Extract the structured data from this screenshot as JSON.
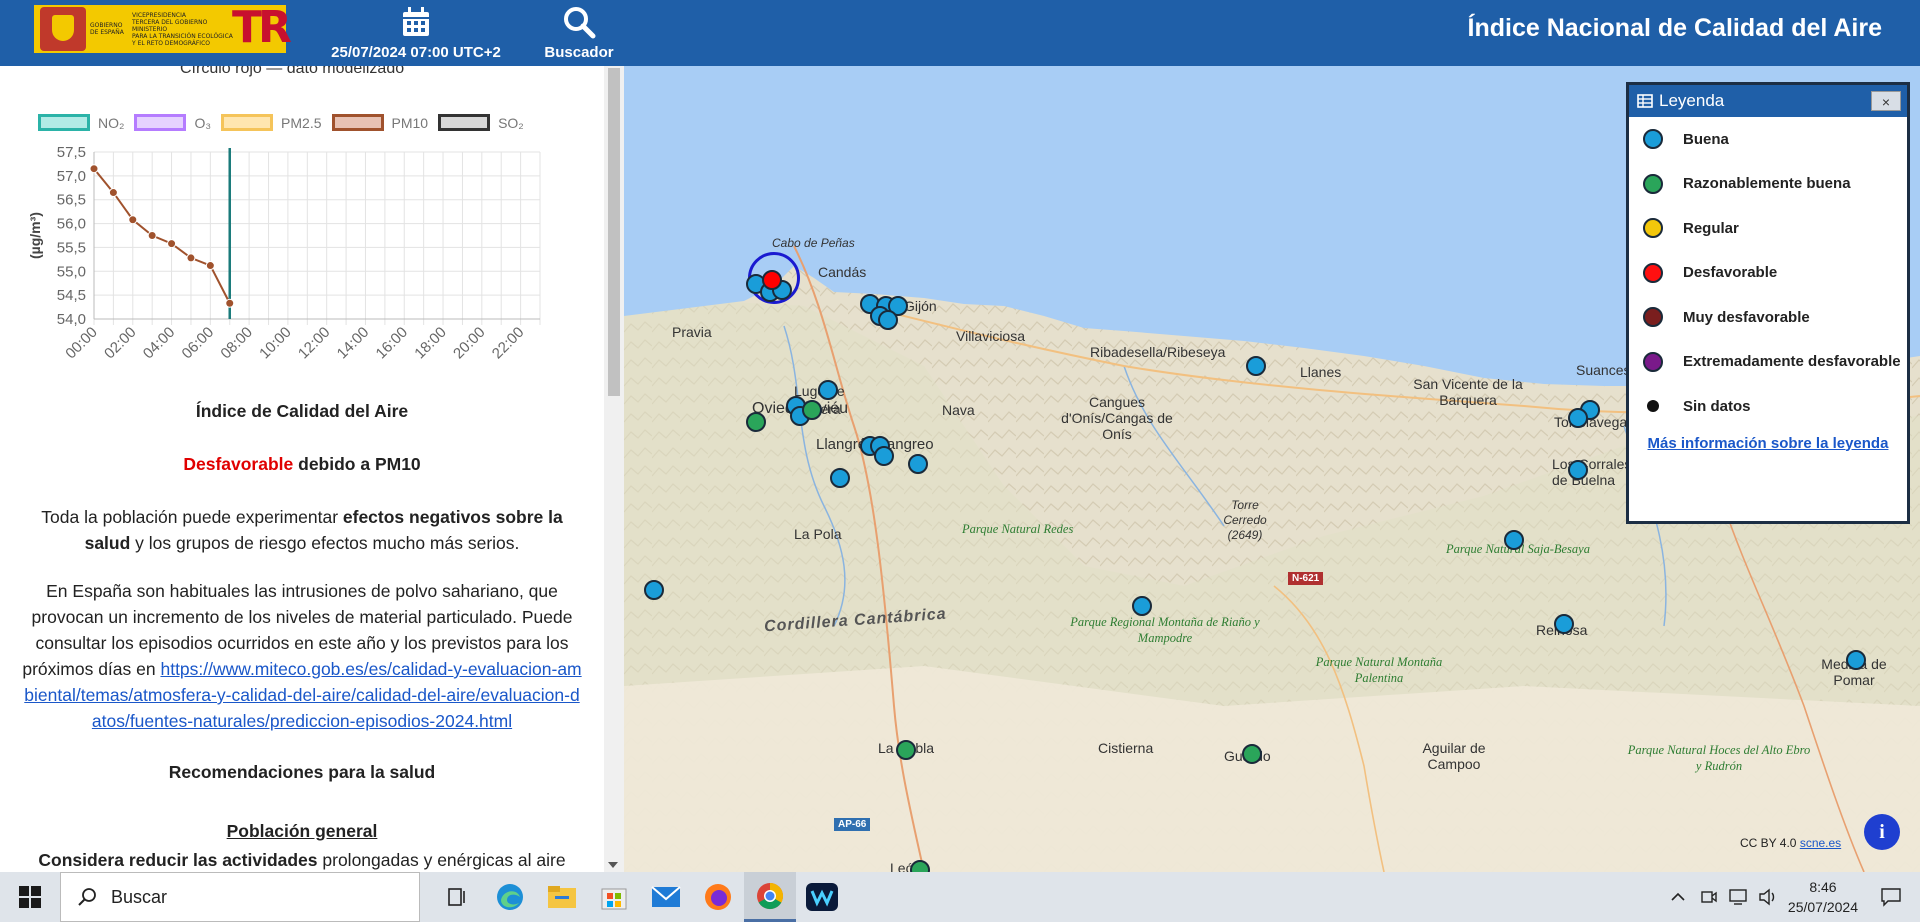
{
  "header": {
    "logo_text_lines": [
      "VICEPRESIDENCIA",
      "TERCERA DEL GOBIERNO",
      "MINISTERIO",
      "PARA LA TRANSICIÓN ECOLÓGICA",
      "Y EL RETO DEMOGRÁFICO"
    ],
    "logo_gov_text": "GOBIERNO DE ESPAÑA",
    "date_label": "25/07/2024 07:00 UTC+2",
    "search_label": "Buscador",
    "title": "Índice Nacional de Calidad del Aire",
    "date_icon": "calendar-icon",
    "search_icon": "search-icon"
  },
  "panel": {
    "cut_text": "Círculo rojo — dato modelizado",
    "pollutant_legend": [
      {
        "label": "NO₂",
        "fill": "#b2ebe6",
        "stroke": "#2bb3a8"
      },
      {
        "label": "O₃",
        "fill": "#e6d2ff",
        "stroke": "#b57cff"
      },
      {
        "label": "PM2.5",
        "fill": "#ffe6b0",
        "stroke": "#f5c45a"
      },
      {
        "label": "PM10",
        "fill": "#e8c2b4",
        "stroke": "#a0522d"
      },
      {
        "label": "SO₂",
        "fill": "#d8d8d8",
        "stroke": "#333333"
      }
    ],
    "index_title": "Índice de Calidad del Aire",
    "status_word": "Desfavorable",
    "status_rest": " debido a PM10",
    "health_p1": "Toda la población puede experimentar ",
    "health_b1": "efectos negativos sobre la salud",
    "health_p2": " y los grupos de riesgo efectos mucho más serios.",
    "dust_text": "En España son habituales las intrusiones de polvo sahariano, que provocan un incremento de los niveles de material particulado. Puede consultar los episodios ocurridos en este año y los previstos para los próximos días en ",
    "dust_link": "https://www.miteco.gob.es/es/calidad-y-evaluacion-ambiental/temas/atmosfera-y-calidad-del-aire/calidad-del-aire/evaluacion-datos/fuentes-naturales/prediccion-episodios-2024.html",
    "reco_title": "Recomendaciones para la salud",
    "pop_title": "Población general",
    "pop_b": "Considera reducir las actividades",
    "pop_rest": " prolongadas y enérgicas al aire libre,"
  },
  "chart_data": {
    "type": "line",
    "title": "",
    "xlabel": "",
    "ylabel": "(µg/m³)",
    "x_ticks": [
      "00:00",
      "02:00",
      "04:00",
      "06:00",
      "08:00",
      "10:00",
      "12:00",
      "14:00",
      "16:00",
      "18:00",
      "20:00",
      "22:00"
    ],
    "y_ticks": [
      "54,0",
      "54,5",
      "55,0",
      "55,5",
      "56,0",
      "56,5",
      "57,0",
      "57,5"
    ],
    "ylim": [
      54.0,
      57.5
    ],
    "xlim_hours": [
      0,
      23
    ],
    "current_hour": 7,
    "series": [
      {
        "name": "PM10",
        "color": "#a0522d",
        "x": [
          0,
          1,
          2,
          3,
          4,
          5,
          6,
          7
        ],
        "values": [
          57.15,
          56.65,
          56.08,
          55.75,
          55.58,
          55.28,
          55.12,
          54.33
        ]
      }
    ],
    "grid": true
  },
  "map": {
    "labels": [
      {
        "text": "Cabo de Peñas",
        "italic": true
      },
      {
        "text": "Candás"
      },
      {
        "text": "Gijón"
      },
      {
        "text": "Pravia"
      },
      {
        "text": "Villaviciosa"
      },
      {
        "text": "Ribadesella/Ribeseya"
      },
      {
        "text": "Llanes"
      },
      {
        "text": "San Vicente de la Barquera"
      },
      {
        "text": "Suances"
      },
      {
        "text": "Lugo de Llanera"
      },
      {
        "text": "Oviedo/Uviéu"
      },
      {
        "text": "Nava"
      },
      {
        "text": "Cangues d'Onís/Cangas de Onís"
      },
      {
        "text": "Llangréu/Langreo"
      },
      {
        "text": "Torrelavega"
      },
      {
        "text": "Los Corrales de Buelna"
      },
      {
        "text": "Torre Cerredo (2649)"
      },
      {
        "text": "La Pola"
      },
      {
        "text": "Cordillera Cantábrica"
      },
      {
        "text": "Reinosa"
      },
      {
        "text": "Medina de Pomar"
      },
      {
        "text": "La Robla"
      },
      {
        "text": "Cistierna"
      },
      {
        "text": "Guardo"
      },
      {
        "text": "Aguilar de Campoo"
      },
      {
        "text": "León"
      }
    ],
    "parks": [
      "Parque Natural Redes",
      "Parque Natural Saja-Besaya",
      "Parque Regional Montaña de Riaño y Mampodre",
      "Parque Natural Montaña Palentina",
      "Parque Natural Hoces del Alto Ebro y Rudrón"
    ],
    "roads": [
      "N-621",
      "AP-66"
    ],
    "attribution_text": "CC BY 4.0 ",
    "attribution_link": "scne.es",
    "info_label": "i"
  },
  "map_legend": {
    "title": "Leyenda",
    "close": "×",
    "items": [
      {
        "label": "Buena",
        "color": "#1a9dd9"
      },
      {
        "label": "Razonablemente buena",
        "color": "#2aa55a"
      },
      {
        "label": "Regular",
        "color": "#f3c70b"
      },
      {
        "label": "Desfavorable",
        "color": "#ff1010"
      },
      {
        "label": "Muy desfavorable",
        "color": "#7a1e1e"
      },
      {
        "label": "Extremadamente desfavorable",
        "color": "#7a1a8a"
      },
      {
        "label": "Sin datos",
        "color": "#111111"
      }
    ],
    "link": "Más información sobre la leyenda"
  },
  "taskbar": {
    "search_placeholder": "Buscar",
    "time": "8:46",
    "date": "25/07/2024",
    "apps": [
      "task-view-icon",
      "edge-icon",
      "file-explorer-icon",
      "store-icon",
      "mail-icon",
      "firefox-icon",
      "chrome-icon",
      "webex-icon"
    ]
  }
}
